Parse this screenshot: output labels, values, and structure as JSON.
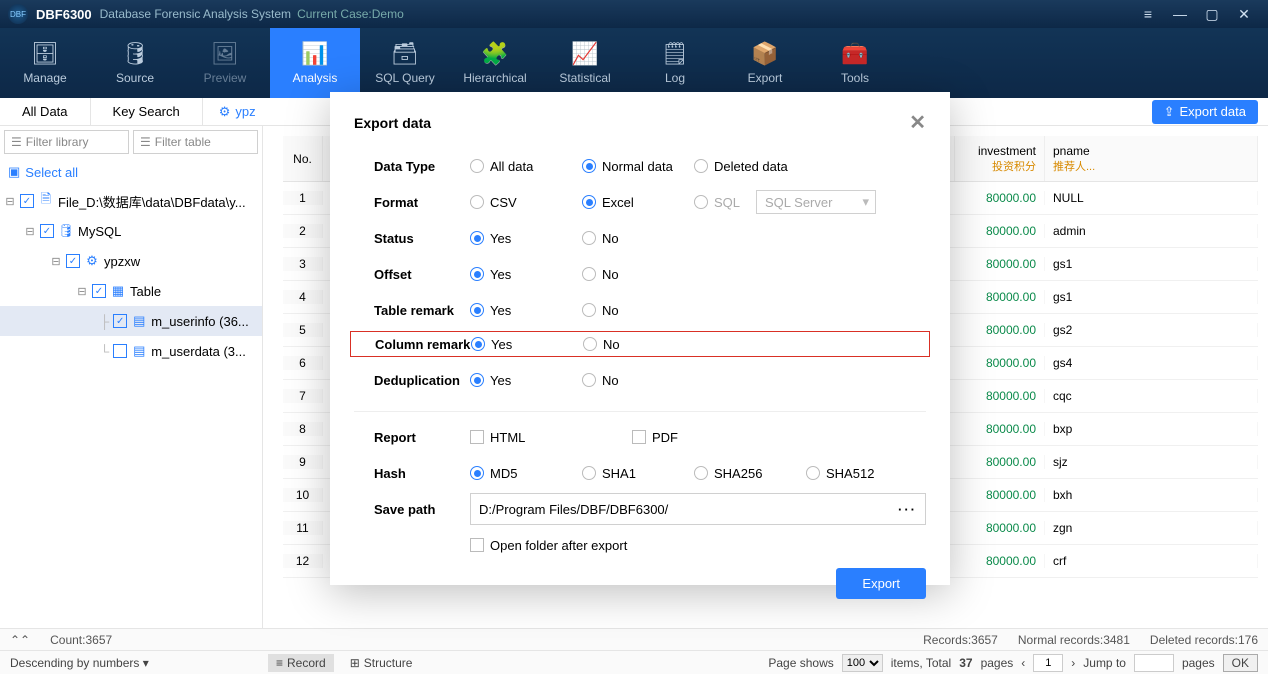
{
  "titlebar": {
    "logo": "DBF",
    "app": "DBF6300",
    "subtitle": "Database Forensic Analysis System",
    "case_prefix": "Current Case:",
    "case_name": "Demo"
  },
  "toolbar": {
    "items": [
      {
        "label": "Manage",
        "icon": "🗄"
      },
      {
        "label": "Source",
        "icon": "🛢"
      },
      {
        "label": "Preview",
        "icon": "🖼"
      },
      {
        "label": "Analysis",
        "icon": "📊"
      },
      {
        "label": "SQL Query",
        "icon": "🗃"
      },
      {
        "label": "Hierarchical",
        "icon": "🧩"
      },
      {
        "label": "Statistical",
        "icon": "📈"
      },
      {
        "label": "Log",
        "icon": "🗒"
      },
      {
        "label": "Export",
        "icon": "📦"
      },
      {
        "label": "Tools",
        "icon": "🧰"
      }
    ],
    "active_index": 3
  },
  "ribbon": {
    "tab_all": "All Data",
    "tab_key": "Key Search",
    "file_tab": "ypz",
    "export_btn": "Export data"
  },
  "sidebar": {
    "filter_library": "Filter library",
    "filter_table": "Filter table",
    "select_all": "Select all",
    "root": "File_D:\\数据库\\data\\DBFdata\\y...",
    "mysql": "MySQL",
    "db": "ypzxw",
    "table_group": "Table",
    "t1": "m_userinfo (36...",
    "t2": "m_userdata (3..."
  },
  "table": {
    "headers": {
      "no": "No.",
      "investment": {
        "en": "investment",
        "ch": "投资积分"
      },
      "pname": {
        "en": "pname",
        "ch": "推荐人..."
      }
    },
    "rows": [
      {
        "no": 1,
        "inv": "80000.00",
        "pn": "NULL"
      },
      {
        "no": 2,
        "inv": "80000.00",
        "pn": "admin"
      },
      {
        "no": 3,
        "inv": "80000.00",
        "pn": "gs1"
      },
      {
        "no": 4,
        "inv": "80000.00",
        "pn": "gs1"
      },
      {
        "no": 5,
        "inv": "80000.00",
        "pn": "gs2"
      },
      {
        "no": 6,
        "inv": "80000.00",
        "pn": "gs4"
      },
      {
        "no": 7,
        "inv": "80000.00",
        "pn": "cqc"
      },
      {
        "no": 8,
        "inv": "80000.00",
        "pn": "bxp"
      },
      {
        "no": 9,
        "inv": "80000.00",
        "pn": "sjz"
      },
      {
        "no": 10,
        "inv": "80000.00",
        "pn": "bxh"
      },
      {
        "no": 11,
        "inv": "80000.00",
        "pn": "zgn"
      },
      {
        "no": 12,
        "inv": "80000.00",
        "pn": "crf"
      }
    ]
  },
  "status": {
    "count_label": "Count:3657",
    "records": "Records:3657",
    "normal": "Normal records:3481",
    "deleted": "Deleted records:176"
  },
  "botbar": {
    "descending": "Descending by numbers",
    "seg_record": "Record",
    "seg_structure": "Structure",
    "page_shows": "Page shows",
    "page_size": "100",
    "items_total_pre": "items, Total",
    "total_pages": "37",
    "items_total_post": "pages",
    "page_input": "1",
    "jump": "Jump to",
    "pages_suffix": "pages",
    "ok": "OK"
  },
  "modal": {
    "title": "Export data",
    "labels": {
      "data_type": "Data Type",
      "format": "Format",
      "status": "Status",
      "offset": "Offset",
      "table_remark": "Table remark",
      "column_remark": "Column remark",
      "deduplication": "Deduplication",
      "report": "Report",
      "hash": "Hash",
      "save_path": "Save path",
      "open_after": "Open folder after export"
    },
    "options": {
      "data_type": [
        "All data",
        "Normal data",
        "Deleted data"
      ],
      "format": [
        "CSV",
        "Excel",
        "SQL"
      ],
      "sql_vendor": "SQL Server",
      "yes": "Yes",
      "no": "No",
      "report": [
        "HTML",
        "PDF"
      ],
      "hash": [
        "MD5",
        "SHA1",
        "SHA256",
        "SHA512"
      ]
    },
    "save_path_value": "D:/Program Files/DBF/DBF6300/",
    "export_btn": "Export"
  }
}
